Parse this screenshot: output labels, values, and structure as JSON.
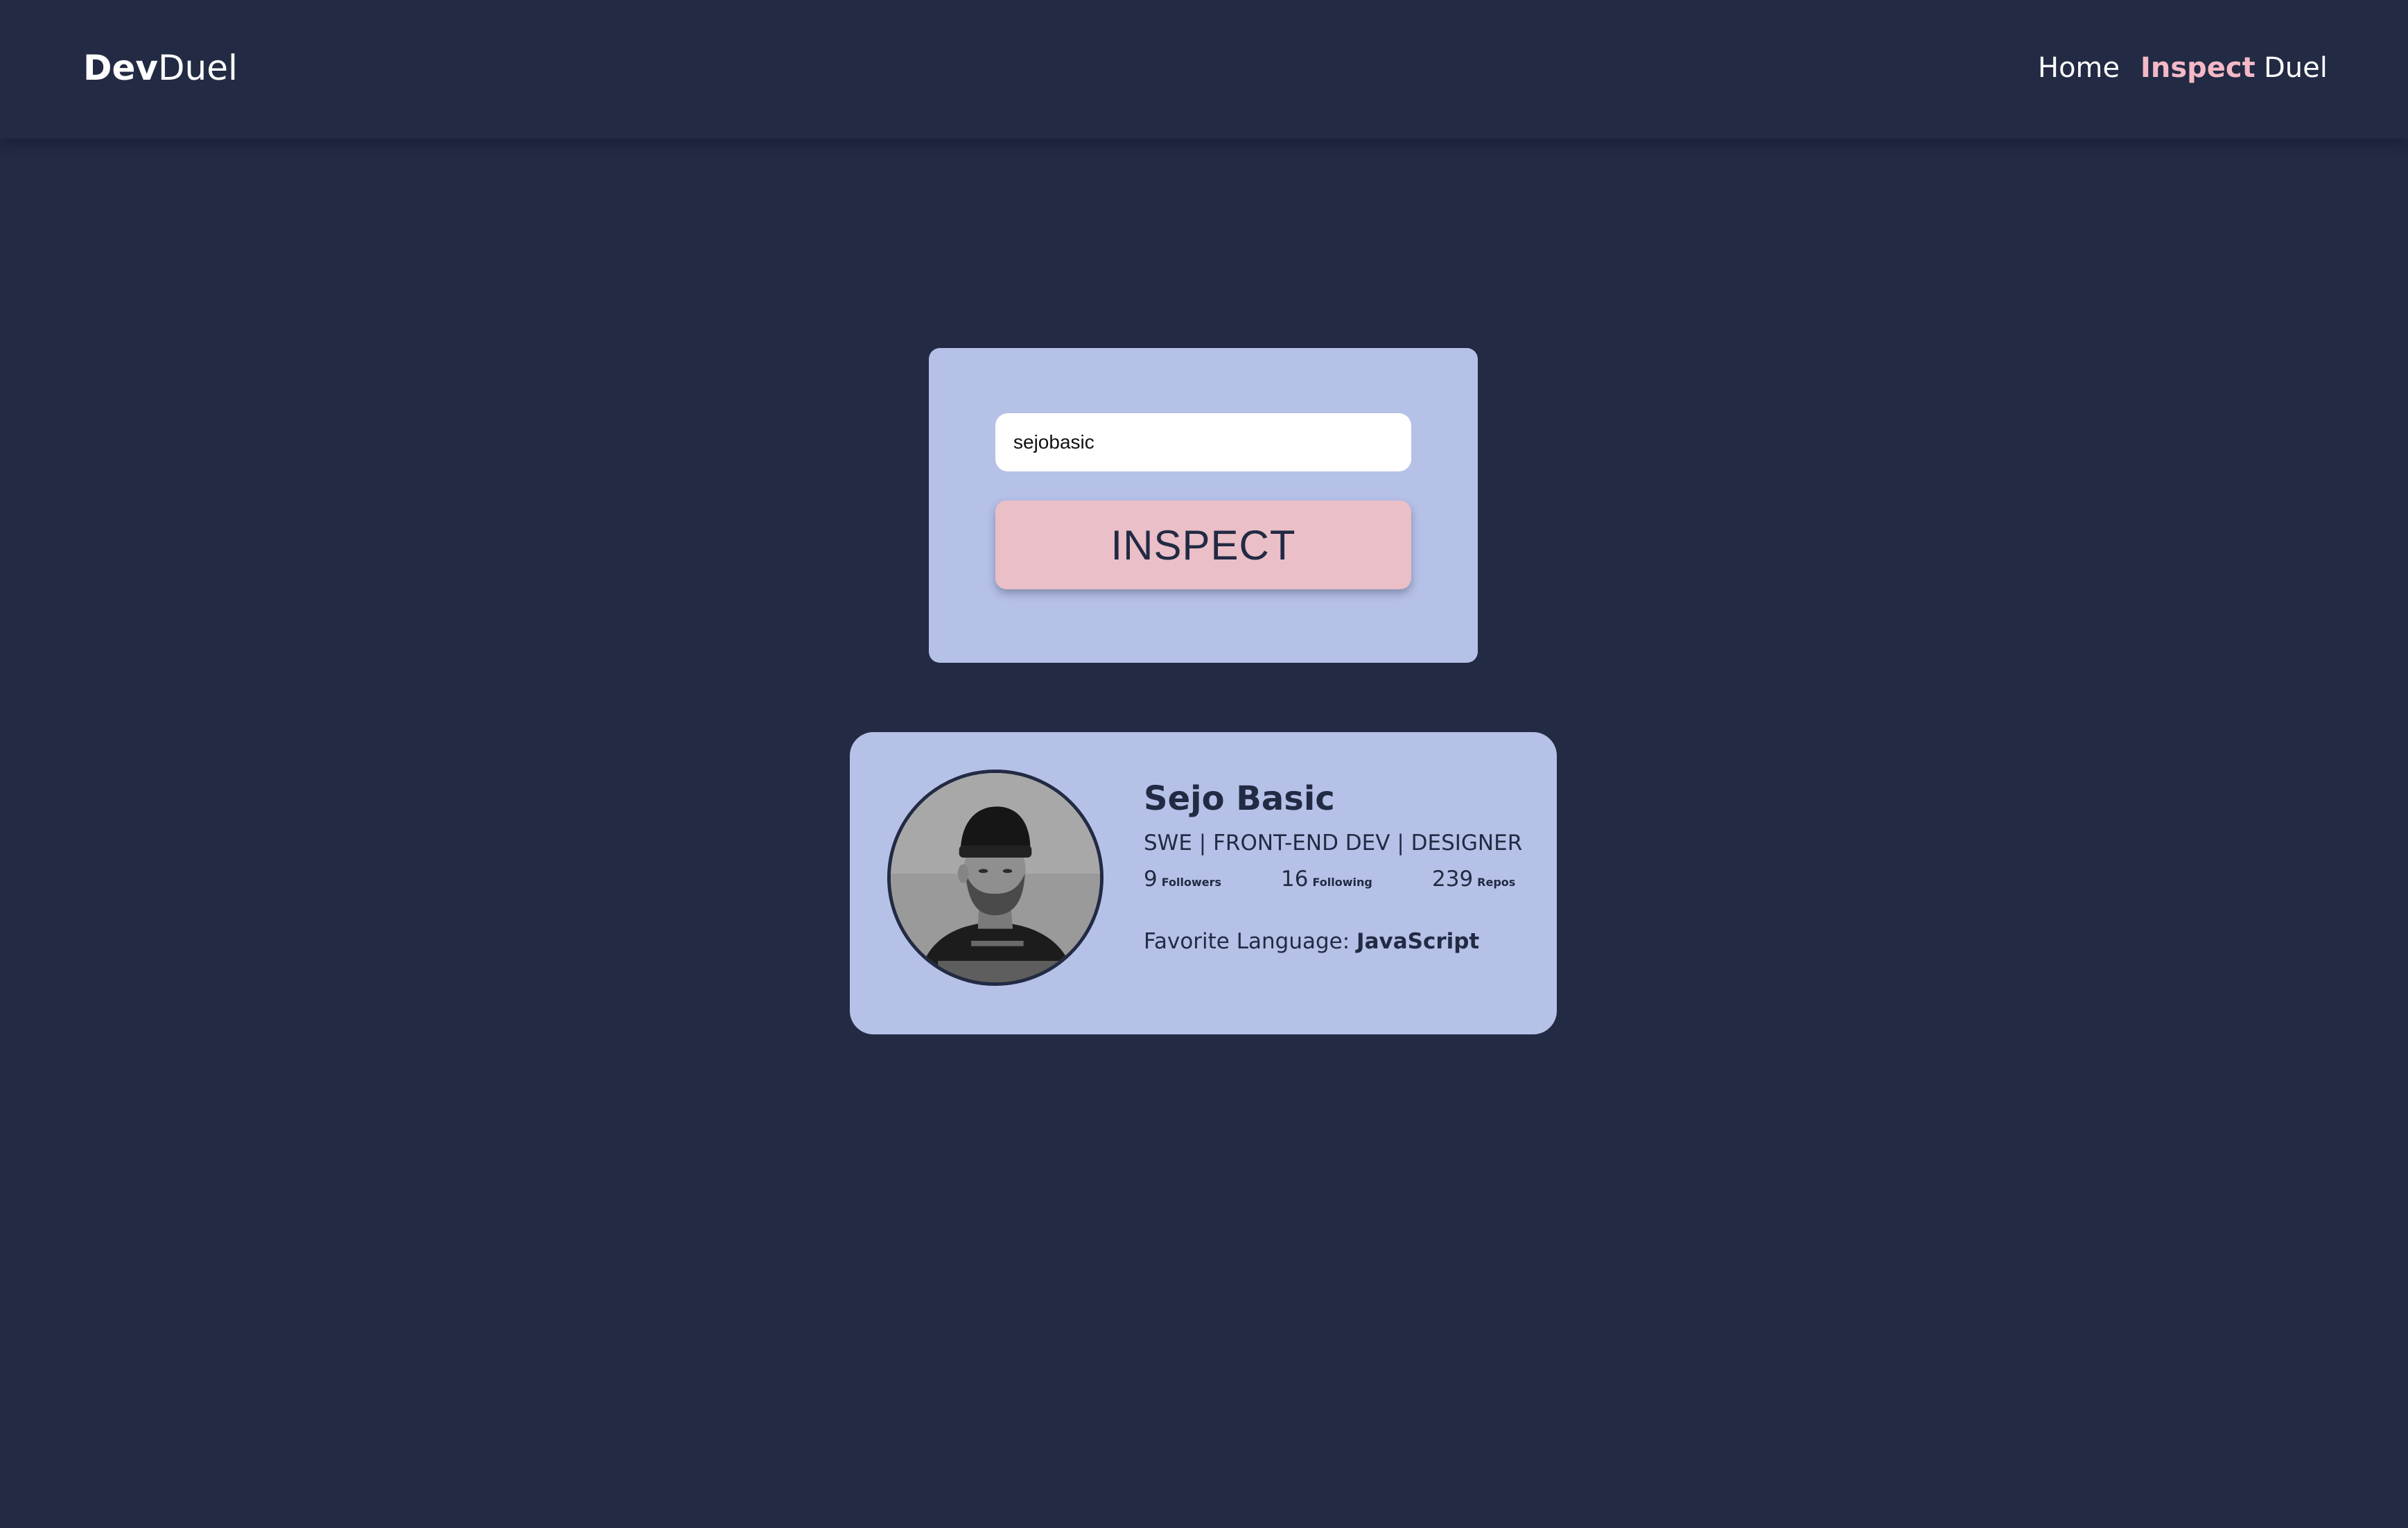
{
  "navbar": {
    "brand_bold": "Dev",
    "brand_light": "Duel",
    "links": [
      {
        "label": "Home",
        "active": false
      },
      {
        "label": "Inspect",
        "active": true
      },
      {
        "label": "Duel",
        "active": false
      }
    ]
  },
  "search": {
    "value": "sejobasic",
    "button_label": "INSPECT"
  },
  "profile": {
    "name": "Sejo Basic",
    "bio": "SWE | FRONT-END DEV | DESIGNER",
    "stats": {
      "followers": {
        "value": "9",
        "label": "Followers"
      },
      "following": {
        "value": "16",
        "label": "Following"
      },
      "repos": {
        "value": "239",
        "label": "Repos"
      }
    },
    "favorite_language_label": "Favorite Language:",
    "favorite_language": "JavaScript",
    "avatar_icon": "user-avatar-photo"
  },
  "colors": {
    "background": "#222a44",
    "card": "#b6c1e7",
    "accent_pink": "#f4b8c6",
    "button": "#eabfc7",
    "text_dark": "#222a44"
  }
}
